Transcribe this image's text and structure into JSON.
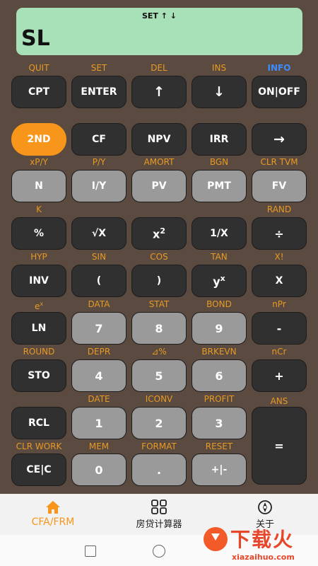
{
  "display": {
    "indicator": "SET ↑ ↓",
    "value": "SL"
  },
  "rows": [
    {
      "labels": [
        {
          "text": "QUIT"
        },
        {
          "text": "SET"
        },
        {
          "text": "DEL"
        },
        {
          "text": "INS"
        },
        {
          "text": "INFO",
          "color": "blue"
        }
      ],
      "keys": [
        {
          "text": "CPT",
          "style": "dark"
        },
        {
          "text": "ENTER",
          "style": "dark"
        },
        {
          "text": "↑",
          "style": "dark",
          "size": "big"
        },
        {
          "text": "↓",
          "style": "dark",
          "size": "big"
        },
        {
          "text": "ON|OFF",
          "style": "dark"
        }
      ]
    },
    {
      "labels": [],
      "keys": [
        {
          "text": "2ND",
          "style": "orange"
        },
        {
          "text": "CF",
          "style": "dark"
        },
        {
          "text": "NPV",
          "style": "dark"
        },
        {
          "text": "IRR",
          "style": "dark"
        },
        {
          "text": "→",
          "style": "dark",
          "size": "big"
        }
      ]
    },
    {
      "labels": [
        {
          "text": "xP/Y"
        },
        {
          "text": "P/Y"
        },
        {
          "text": "AMORT"
        },
        {
          "text": "BGN"
        },
        {
          "text": "CLR TVM"
        }
      ],
      "keys": [
        {
          "text": "N",
          "style": "gray"
        },
        {
          "text": "I/Y",
          "style": "gray"
        },
        {
          "text": "PV",
          "style": "gray"
        },
        {
          "text": "PMT",
          "style": "gray"
        },
        {
          "text": "FV",
          "style": "gray"
        }
      ]
    },
    {
      "labels": [
        {
          "text": "K"
        },
        {
          "text": ""
        },
        {
          "text": ""
        },
        {
          "text": ""
        },
        {
          "text": "RAND"
        }
      ],
      "keys": [
        {
          "text": "%",
          "style": "dark"
        },
        {
          "text": "√X",
          "style": "dark"
        },
        {
          "text": "x",
          "sup": "2",
          "style": "dark",
          "size": "mid"
        },
        {
          "text": "1/X",
          "style": "dark"
        },
        {
          "text": "÷",
          "style": "dark",
          "size": "mid"
        }
      ]
    },
    {
      "labels": [
        {
          "text": "HYP"
        },
        {
          "text": "SIN"
        },
        {
          "text": "COS"
        },
        {
          "text": "TAN"
        },
        {
          "text": "X!"
        }
      ],
      "keys": [
        {
          "text": "INV",
          "style": "dark"
        },
        {
          "text": "(",
          "style": "dark"
        },
        {
          "text": ")",
          "style": "dark"
        },
        {
          "text": "y",
          "sup": "x",
          "style": "dark",
          "size": "mid"
        },
        {
          "text": "X",
          "style": "dark"
        }
      ]
    },
    {
      "labels": [
        {
          "text": "e",
          "sup": "x"
        },
        {
          "text": "DATA"
        },
        {
          "text": "STAT"
        },
        {
          "text": "BOND"
        },
        {
          "text": "nPr"
        }
      ],
      "keys": [
        {
          "text": "LN",
          "style": "dark"
        },
        {
          "text": "7",
          "style": "gray",
          "size": "mid"
        },
        {
          "text": "8",
          "style": "gray",
          "size": "mid"
        },
        {
          "text": "9",
          "style": "gray",
          "size": "mid"
        },
        {
          "text": "-",
          "style": "dark",
          "size": "mid"
        }
      ]
    },
    {
      "labels": [
        {
          "text": "ROUND"
        },
        {
          "text": "DEPR"
        },
        {
          "text": "⊿%"
        },
        {
          "text": "BRKEVN"
        },
        {
          "text": "nCr"
        }
      ],
      "keys": [
        {
          "text": "STO",
          "style": "dark"
        },
        {
          "text": "4",
          "style": "gray",
          "size": "mid"
        },
        {
          "text": "5",
          "style": "gray",
          "size": "mid"
        },
        {
          "text": "6",
          "style": "gray",
          "size": "mid"
        },
        {
          "text": "+",
          "style": "dark",
          "size": "mid"
        }
      ]
    },
    {
      "labels": [
        {
          "text": ""
        },
        {
          "text": "DATE"
        },
        {
          "text": "ICONV"
        },
        {
          "text": "PROFIT"
        },
        {
          "text": "ANS"
        }
      ],
      "keys": [
        {
          "text": "RCL",
          "style": "dark"
        },
        {
          "text": "1",
          "style": "gray",
          "size": "mid"
        },
        {
          "text": "2",
          "style": "gray",
          "size": "mid"
        },
        {
          "text": "3",
          "style": "gray",
          "size": "mid"
        },
        {
          "text": "=",
          "style": "dark",
          "size": "mid",
          "tall": true
        }
      ]
    },
    {
      "labels": [
        {
          "text": "CLR WORK"
        },
        {
          "text": "MEM"
        },
        {
          "text": "FORMAT"
        },
        {
          "text": "RESET"
        },
        {
          "text": ""
        }
      ],
      "keys": [
        {
          "text": "CE|C",
          "style": "dark"
        },
        {
          "text": "0",
          "style": "gray",
          "size": "mid"
        },
        {
          "text": ".",
          "style": "gray",
          "size": "mid"
        },
        {
          "text": "+|-",
          "style": "gray"
        }
      ]
    }
  ],
  "nav": {
    "items": [
      {
        "label": "CFA/FRM",
        "icon": "home-icon",
        "active": true
      },
      {
        "label": "房贷计算器",
        "icon": "grid-icon",
        "active": false
      },
      {
        "label": "关于",
        "icon": "compass-icon",
        "active": false
      }
    ]
  },
  "watermark": {
    "title": "下载火",
    "site": "xiazaihuo.com"
  },
  "colors": {
    "accent": "#f7961b",
    "display_bg": "#a8e0b8",
    "body_bg": "#5b4a3f",
    "info_blue": "#3c8cff"
  }
}
